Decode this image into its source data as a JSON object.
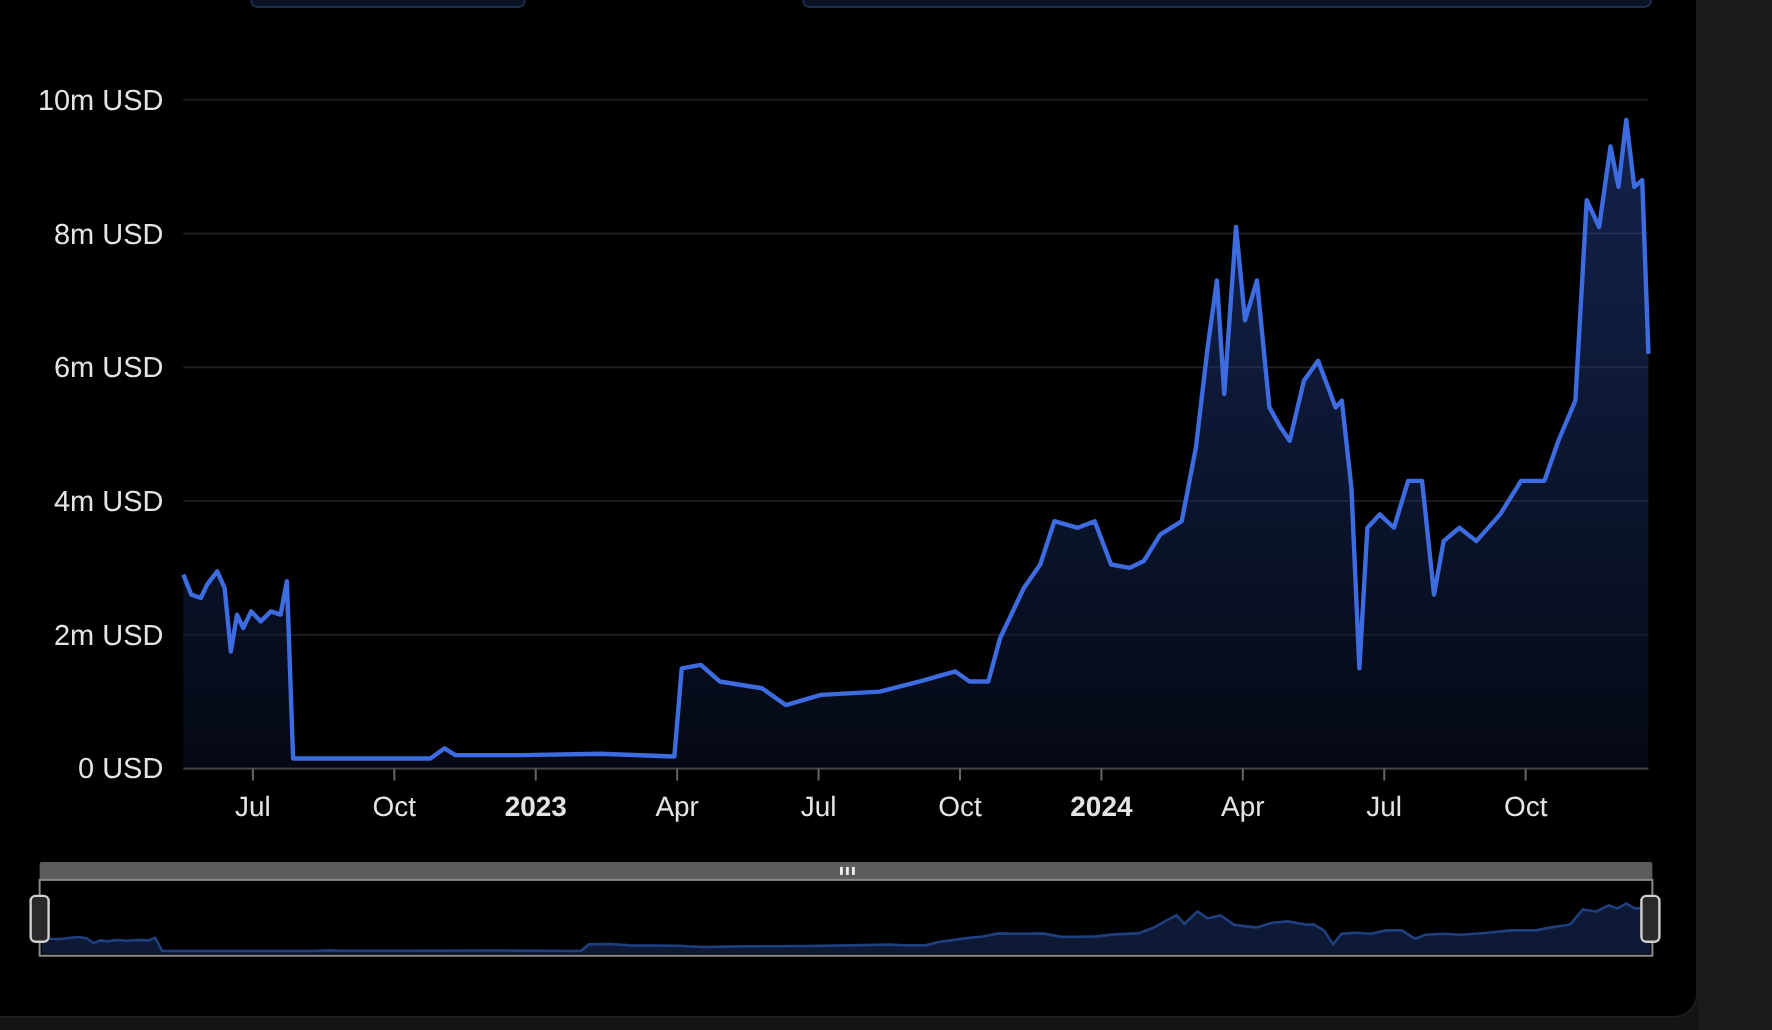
{
  "top_buttons": [
    {
      "kind": "short"
    },
    {
      "kind": "wide"
    }
  ],
  "chart": {
    "chart_data": {
      "type": "area",
      "grid": true,
      "xlim": [
        2022.377,
        2024.967
      ],
      "ylim": [
        0,
        10
      ],
      "yticks": [
        {
          "value": 0,
          "label": "0 USD"
        },
        {
          "value": 2,
          "label": "2m USD"
        },
        {
          "value": 4,
          "label": "4m USD"
        },
        {
          "value": 6,
          "label": "6m USD"
        },
        {
          "value": 8,
          "label": "8m USD"
        },
        {
          "value": 10,
          "label": "10m USD"
        }
      ],
      "xticks": [
        {
          "value": 2022.5,
          "label": "Jul"
        },
        {
          "value": 2022.75,
          "label": "Oct"
        },
        {
          "value": 2023,
          "label": "2023"
        },
        {
          "value": 2023.25,
          "label": "Apr"
        },
        {
          "value": 2023.5,
          "label": "Jul"
        },
        {
          "value": 2023.75,
          "label": "Oct"
        },
        {
          "value": 2024,
          "label": "2024"
        },
        {
          "value": 2024.25,
          "label": "Apr"
        },
        {
          "value": 2024.5,
          "label": "Jul"
        },
        {
          "value": 2024.75,
          "label": "Oct"
        }
      ],
      "x": [
        2022.377,
        2022.391,
        2022.408,
        2022.419,
        2022.437,
        2022.45,
        2022.461,
        2022.472,
        2022.483,
        2022.497,
        2022.514,
        2022.532,
        2022.549,
        2022.56,
        2022.571,
        2022.762,
        2022.814,
        2022.839,
        2022.858,
        2022.975,
        2023.114,
        2023.245,
        2023.258,
        2023.292,
        2023.325,
        2023.4,
        2023.442,
        2023.504,
        2023.608,
        2023.679,
        2023.742,
        2023.767,
        2023.8,
        2023.821,
        2023.863,
        2023.892,
        2023.917,
        2023.958,
        2023.988,
        2024.017,
        2024.05,
        2024.075,
        2024.104,
        2024.142,
        2024.167,
        2024.188,
        2024.204,
        2024.217,
        2024.238,
        2024.254,
        2024.275,
        2024.297,
        2024.317,
        2024.333,
        2024.358,
        2024.383,
        2024.414,
        2024.425,
        2024.442,
        2024.456,
        2024.47,
        2024.492,
        2024.517,
        2024.542,
        2024.567,
        2024.588,
        2024.605,
        2024.633,
        2024.663,
        2024.705,
        2024.742,
        2024.783,
        2024.808,
        2024.838,
        2024.858,
        2024.88,
        2024.9,
        2024.914,
        2024.928,
        2024.942,
        2024.956,
        2024.967
      ],
      "series": [
        {
          "color": "#3d6be0",
          "values": [
            2.9,
            2.6,
            2.55,
            2.75,
            2.95,
            2.7,
            1.75,
            2.3,
            2.1,
            2.35,
            2.2,
            2.35,
            2.3,
            2.8,
            0.15,
            0.15,
            0.15,
            0.3,
            0.2,
            0.2,
            0.22,
            0.18,
            1.5,
            1.55,
            1.3,
            1.2,
            0.95,
            1.1,
            1.15,
            1.3,
            1.45,
            1.3,
            1.3,
            1.95,
            2.7,
            3.05,
            3.7,
            3.6,
            3.7,
            3.05,
            3.0,
            3.1,
            3.5,
            3.7,
            4.8,
            6.3,
            7.3,
            5.6,
            8.1,
            6.7,
            7.3,
            5.4,
            5.1,
            4.9,
            5.8,
            6.1,
            5.4,
            5.5,
            4.2,
            1.5,
            3.6,
            3.8,
            3.6,
            4.3,
            4.3,
            2.6,
            3.4,
            3.6,
            3.4,
            3.8,
            4.3,
            4.3,
            4.9,
            5.5,
            8.5,
            8.1,
            9.3,
            8.7,
            9.7,
            8.7,
            8.8,
            6.2
          ]
        }
      ]
    }
  }
}
